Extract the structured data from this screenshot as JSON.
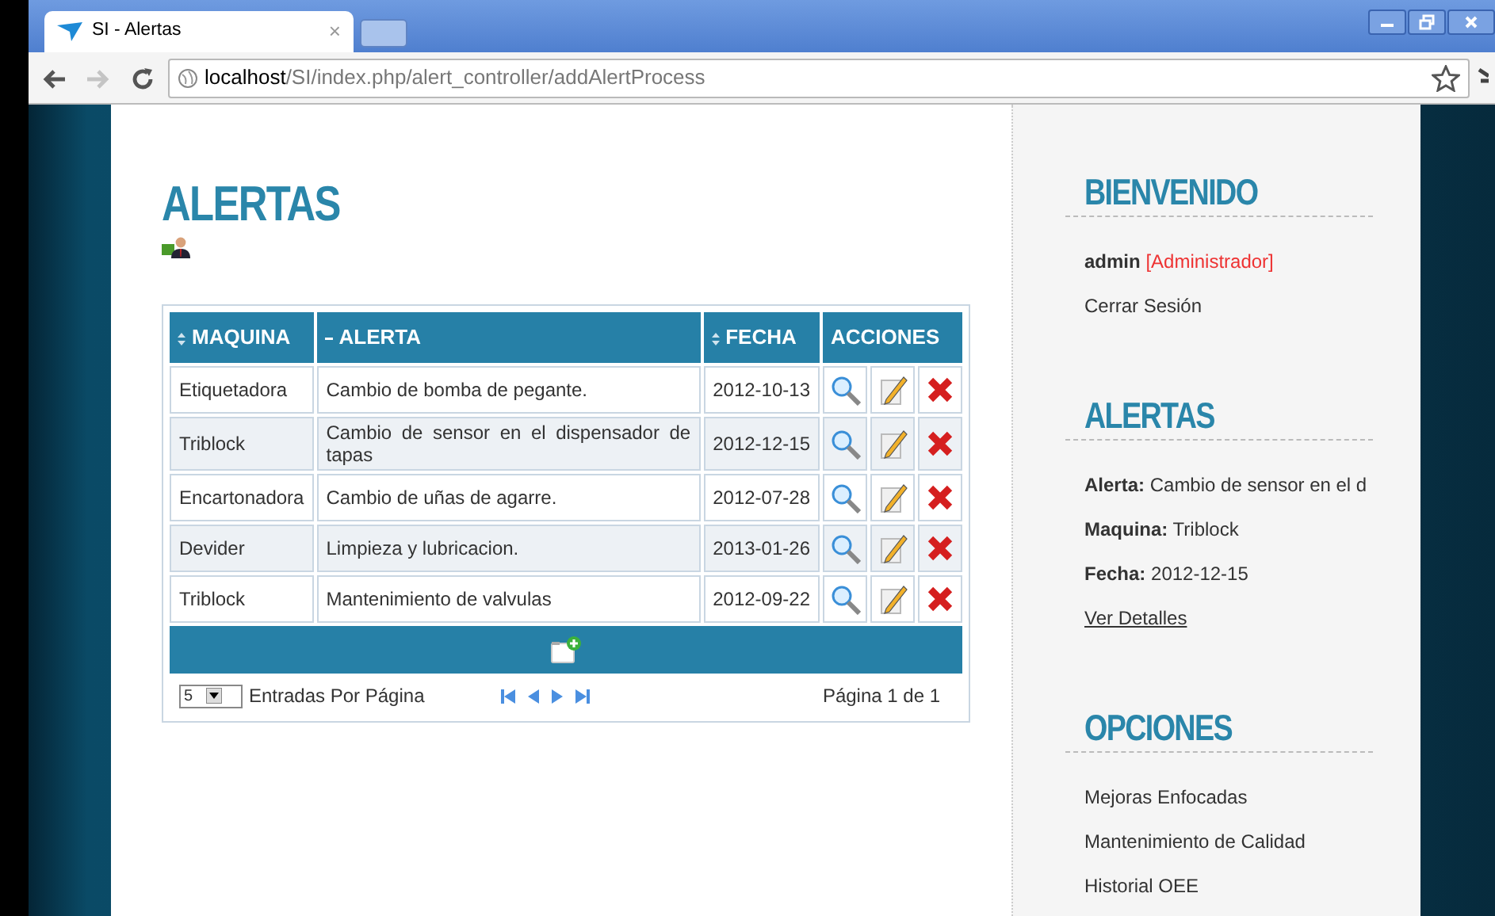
{
  "browser": {
    "tab_title": "SI - Alertas",
    "tab_close": "×",
    "url_host": "localhost",
    "url_path": "/SI/index.php/alert_controller/addAlertProcess",
    "forward_disabled": true
  },
  "main": {
    "title": "ALERTAS",
    "table": {
      "columns": [
        {
          "label": "MAQUINA",
          "kind": "sortable"
        },
        {
          "label": "ALERTA",
          "kind": "sorted"
        },
        {
          "label": "FECHA",
          "kind": "sortable"
        },
        {
          "label": "ACCIONES",
          "kind": "plain"
        }
      ],
      "rows": [
        {
          "maquina": "Etiquetadora",
          "alerta": "Cambio de bomba de pegante.",
          "fecha": "2012-10-13"
        },
        {
          "maquina": "Triblock",
          "alerta": "Cambio de sensor en el dispensador de tapas",
          "fecha": "2012-12-15"
        },
        {
          "maquina": "Encartonadora",
          "alerta": "Cambio de uñas de agarre.",
          "fecha": "2012-07-28"
        },
        {
          "maquina": "Devider",
          "alerta": "Limpieza y lubricacion.",
          "fecha": "2013-01-26"
        },
        {
          "maquina": "Triblock",
          "alerta": "Mantenimiento de valvulas",
          "fecha": "2012-09-22"
        }
      ],
      "page_size": "5",
      "page_size_label": "Entradas Por Página",
      "page_info": "Página 1 de 1"
    }
  },
  "sidebar": {
    "welcome_title": "BIENVENIDO",
    "user": "admin",
    "role": "[Administrador]",
    "logout": "Cerrar Sesión",
    "alerts_title": "ALERTAS",
    "alert_fields": [
      {
        "label": "Alerta:",
        "value": "Cambio de sensor en el d"
      },
      {
        "label": "Maquina:",
        "value": "Triblock"
      },
      {
        "label": "Fecha:",
        "value": "2012-12-15"
      }
    ],
    "details_link": "Ver Detalles",
    "options_title": "OPCIONES",
    "options": [
      "Mejoras Enfocadas",
      "Mantenimiento de Calidad",
      "Historial OEE"
    ]
  }
}
